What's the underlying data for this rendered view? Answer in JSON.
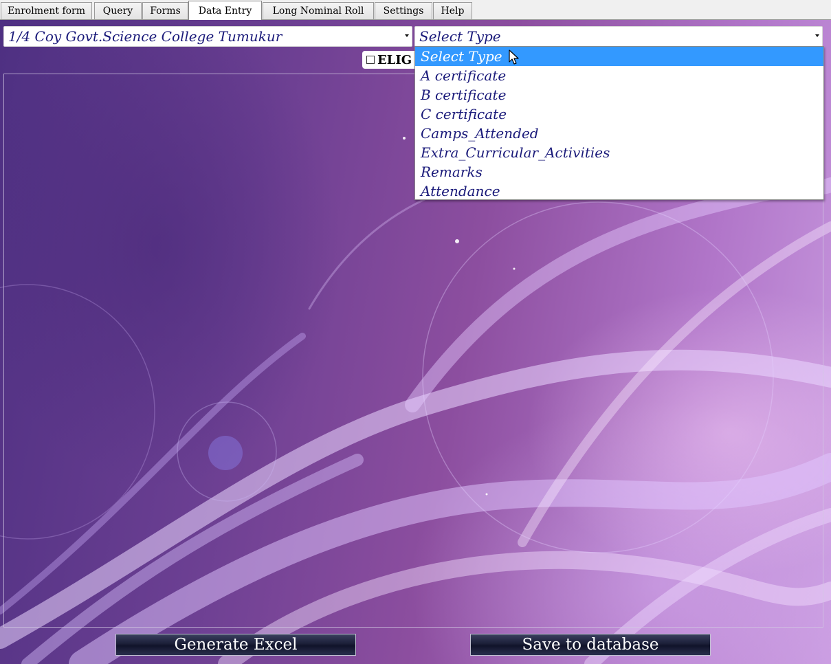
{
  "tabs": [
    {
      "label": "Enrolment form",
      "active": false
    },
    {
      "label": "Query",
      "active": false
    },
    {
      "label": "Forms",
      "active": false
    },
    {
      "label": "Data Entry",
      "active": true
    },
    {
      "label": "Long Nominal Roll",
      "active": false
    },
    {
      "label": "Settings",
      "active": false
    },
    {
      "label": "Help",
      "active": false
    }
  ],
  "unit_select": {
    "value": "1/4 Coy Govt.Science College Tumukur"
  },
  "type_select": {
    "value": "Select Type",
    "options": [
      "Select Type",
      "A certificate",
      "B certificate",
      "C certificate",
      "Camps_Attended",
      "Extra_Curricular_Activities",
      "Remarks",
      "Attendance"
    ],
    "highlighted_index": 0
  },
  "eligible_checkbox": {
    "label": "ELIG",
    "checked": false
  },
  "buttons": {
    "generate_excel": "Generate Excel",
    "save_to_database": "Save to database"
  },
  "colors": {
    "highlight": "#3399ff",
    "option_text": "#1a1a7a",
    "button_bg": "#1b1f38"
  }
}
